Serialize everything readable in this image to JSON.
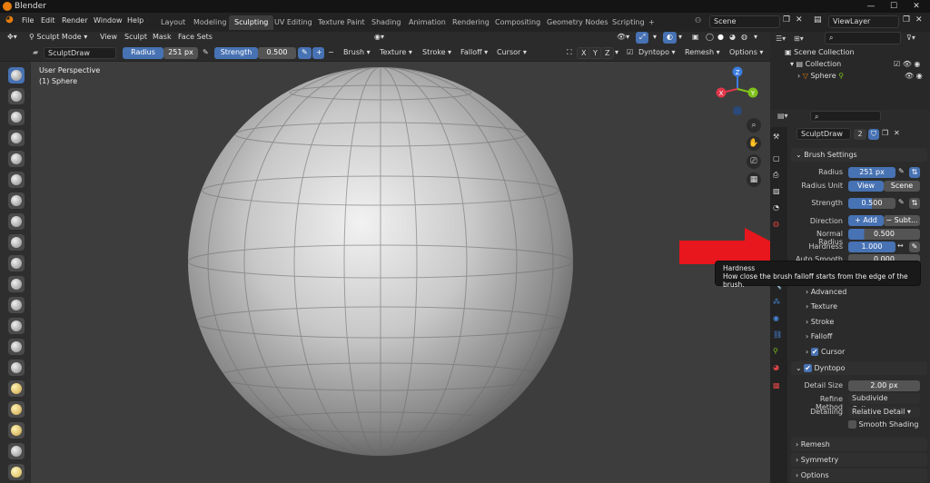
{
  "window": {
    "title": "Blender"
  },
  "menu": {
    "items": [
      "File",
      "Edit",
      "Render",
      "Window",
      "Help"
    ]
  },
  "workspaces": [
    "Layout",
    "Modeling",
    "Sculpting",
    "UV Editing",
    "Texture Paint",
    "Shading",
    "Animation",
    "Rendering",
    "Compositing",
    "Geometry Nodes",
    "Scripting",
    "+"
  ],
  "scene": {
    "name": "Scene",
    "view_layer": "ViewLayer"
  },
  "header": {
    "mode": "Sculpt Mode",
    "menus": [
      "View",
      "Sculpt",
      "Mask",
      "Face Sets"
    ]
  },
  "tool_header": {
    "brush_name": "SculptDraw",
    "radius_label": "Radius",
    "radius_value": "251 px",
    "strength_label": "Strength",
    "strength_value": "0.500",
    "plus": "+",
    "minus": "−",
    "dropdowns": [
      "Brush",
      "Texture",
      "Stroke",
      "Falloff",
      "Cursor"
    ],
    "axes": [
      "X",
      "Y",
      "Z"
    ],
    "dyntopo": "Dyntopo",
    "remesh": "Remesh",
    "options": "Options"
  },
  "viewport": {
    "perspective": "User Perspective",
    "object": "(1) Sphere"
  },
  "gizmo": {
    "x": "X",
    "y": "Y",
    "z": "Z"
  },
  "outliner": {
    "root": "Scene Collection",
    "collection": "Collection",
    "object": "Sphere"
  },
  "properties": {
    "brush_name": "SculptDraw",
    "users": "2",
    "brush_settings": "Brush Settings",
    "radius_label": "Radius",
    "radius_value": "251 px",
    "radius_unit_label": "Radius Unit",
    "radius_unit_view": "View",
    "radius_unit_scene": "Scene",
    "strength_label": "Strength",
    "strength_value": "0.500",
    "direction_label": "Direction",
    "direction_add": "Add",
    "direction_sub": "Subt...",
    "normal_radius_label": "Normal Radius",
    "normal_radius_value": "0.500",
    "hardness_label": "Hardness",
    "hardness_value": "1.000",
    "auto_smooth_label": "Auto Smooth",
    "auto_smooth_value": "0.000",
    "sections": [
      "Advanced",
      "Texture",
      "Stroke",
      "Falloff",
      "Cursor"
    ],
    "dyntopo": "Dyntopo",
    "detail_size_label": "Detail Size",
    "detail_size_value": "2.00 px",
    "refine_label": "Refine Method",
    "refine_value": "Subdivide Collapse",
    "detailing_label": "Detailing",
    "detailing_value": "Relative Detail",
    "smooth_shading": "Smooth Shading",
    "remesh": "Remesh",
    "symmetry": "Symmetry",
    "options": "Options"
  },
  "tooltip": {
    "title": "Hardness",
    "body": "How close the brush falloff starts from the edge of the brush."
  },
  "colors": {
    "accent": "#4772b3",
    "arrow": "#e8161d",
    "x_axis": "#e0374a",
    "y_axis": "#7fc21a",
    "z_axis": "#3b7de0"
  }
}
